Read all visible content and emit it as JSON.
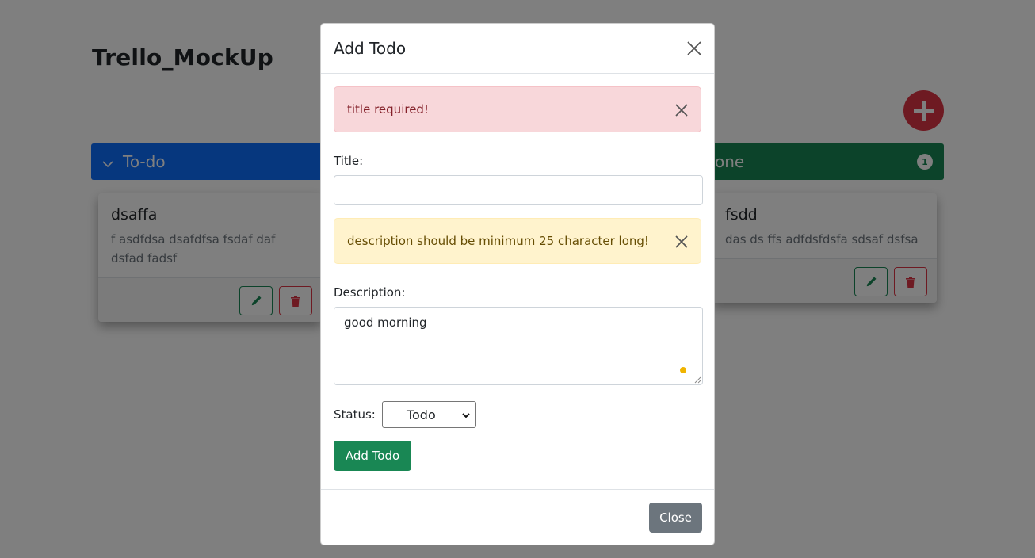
{
  "app": {
    "title": "Trello_MockUp"
  },
  "columns": [
    {
      "name": "To-do",
      "card": {
        "title": "dsaffa",
        "text": "f asdfdsa dsafdfsa fsdaf daf dsfad fadsf"
      }
    },
    {
      "name": "one",
      "badge": "1",
      "card": {
        "title": "fsdd",
        "text": "das ds ffs adfdsfdsfa sdsaf dsfsa"
      }
    }
  ],
  "modal": {
    "title": "Add Todo",
    "alerts": {
      "title_error": "title required!",
      "description_error": "description should be minimum 25 character long!"
    },
    "fields": {
      "title_label": "Title:",
      "title_value": "",
      "description_label": "Description:",
      "description_value": "good morning",
      "status_label": "Status:",
      "status_selected": "Todo"
    },
    "submit_label": "Add Todo",
    "close_label": "Close"
  },
  "colors": {
    "primary": "#0d6efd",
    "success": "#198754",
    "danger": "#dc3545",
    "secondary": "#6c757d"
  },
  "icons": [
    "plus-icon",
    "chevron-down-icon",
    "pencil-icon",
    "trash-icon",
    "close-icon"
  ]
}
